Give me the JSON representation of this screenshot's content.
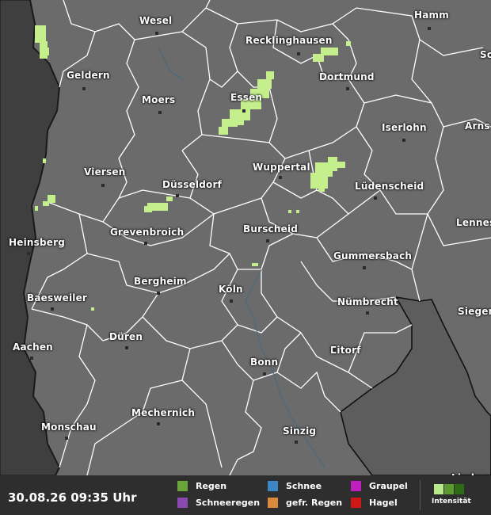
{
  "map": {
    "cities": [
      {
        "name": "Hamm"
      },
      {
        "name": "Wesel"
      },
      {
        "name": "Recklinghausen"
      },
      {
        "name": "So"
      },
      {
        "name": "Geldern"
      },
      {
        "name": "Dortmund"
      },
      {
        "name": "Moers"
      },
      {
        "name": "Essen"
      },
      {
        "name": "Iserlohn"
      },
      {
        "name": "Arns"
      },
      {
        "name": "Viersen"
      },
      {
        "name": "Wuppertal"
      },
      {
        "name": "Düsseldorf"
      },
      {
        "name": "Lüdenscheid"
      },
      {
        "name": "Lennes"
      },
      {
        "name": "Burscheid"
      },
      {
        "name": "Heinsberg"
      },
      {
        "name": "Grevenbroich"
      },
      {
        "name": "Gummersbach"
      },
      {
        "name": "Bergheim"
      },
      {
        "name": "Köln"
      },
      {
        "name": "Baesweiler"
      },
      {
        "name": "Nümbrecht"
      },
      {
        "name": "Siegen"
      },
      {
        "name": "Düren"
      },
      {
        "name": "Aachen"
      },
      {
        "name": "Eitorf"
      },
      {
        "name": "Bonn"
      },
      {
        "name": "Mechernich"
      },
      {
        "name": "Monschau"
      },
      {
        "name": "Sinzig"
      },
      {
        "name": "Limburg"
      }
    ]
  },
  "legend": {
    "timestamp": "30.08.26 09:35 Uhr",
    "items": [
      {
        "label": "Regen",
        "color": "#6aa53a"
      },
      {
        "label": "Schneeregen",
        "color": "#8a48b0"
      },
      {
        "label": "Schnee",
        "color": "#3d86c6"
      },
      {
        "label": "gefr. Regen",
        "color": "#d98a3a"
      },
      {
        "label": "Graupel",
        "color": "#c01fc0"
      },
      {
        "label": "Hagel",
        "color": "#d01818"
      }
    ],
    "intensity_label": "Intensität",
    "intensity_colors": [
      "#b9e98a",
      "#5a9a2e",
      "#2f6a16"
    ]
  },
  "colors": {
    "land": "#6b6b6b",
    "outside": "#3f3f3f",
    "rain": "#c4ef8c"
  }
}
